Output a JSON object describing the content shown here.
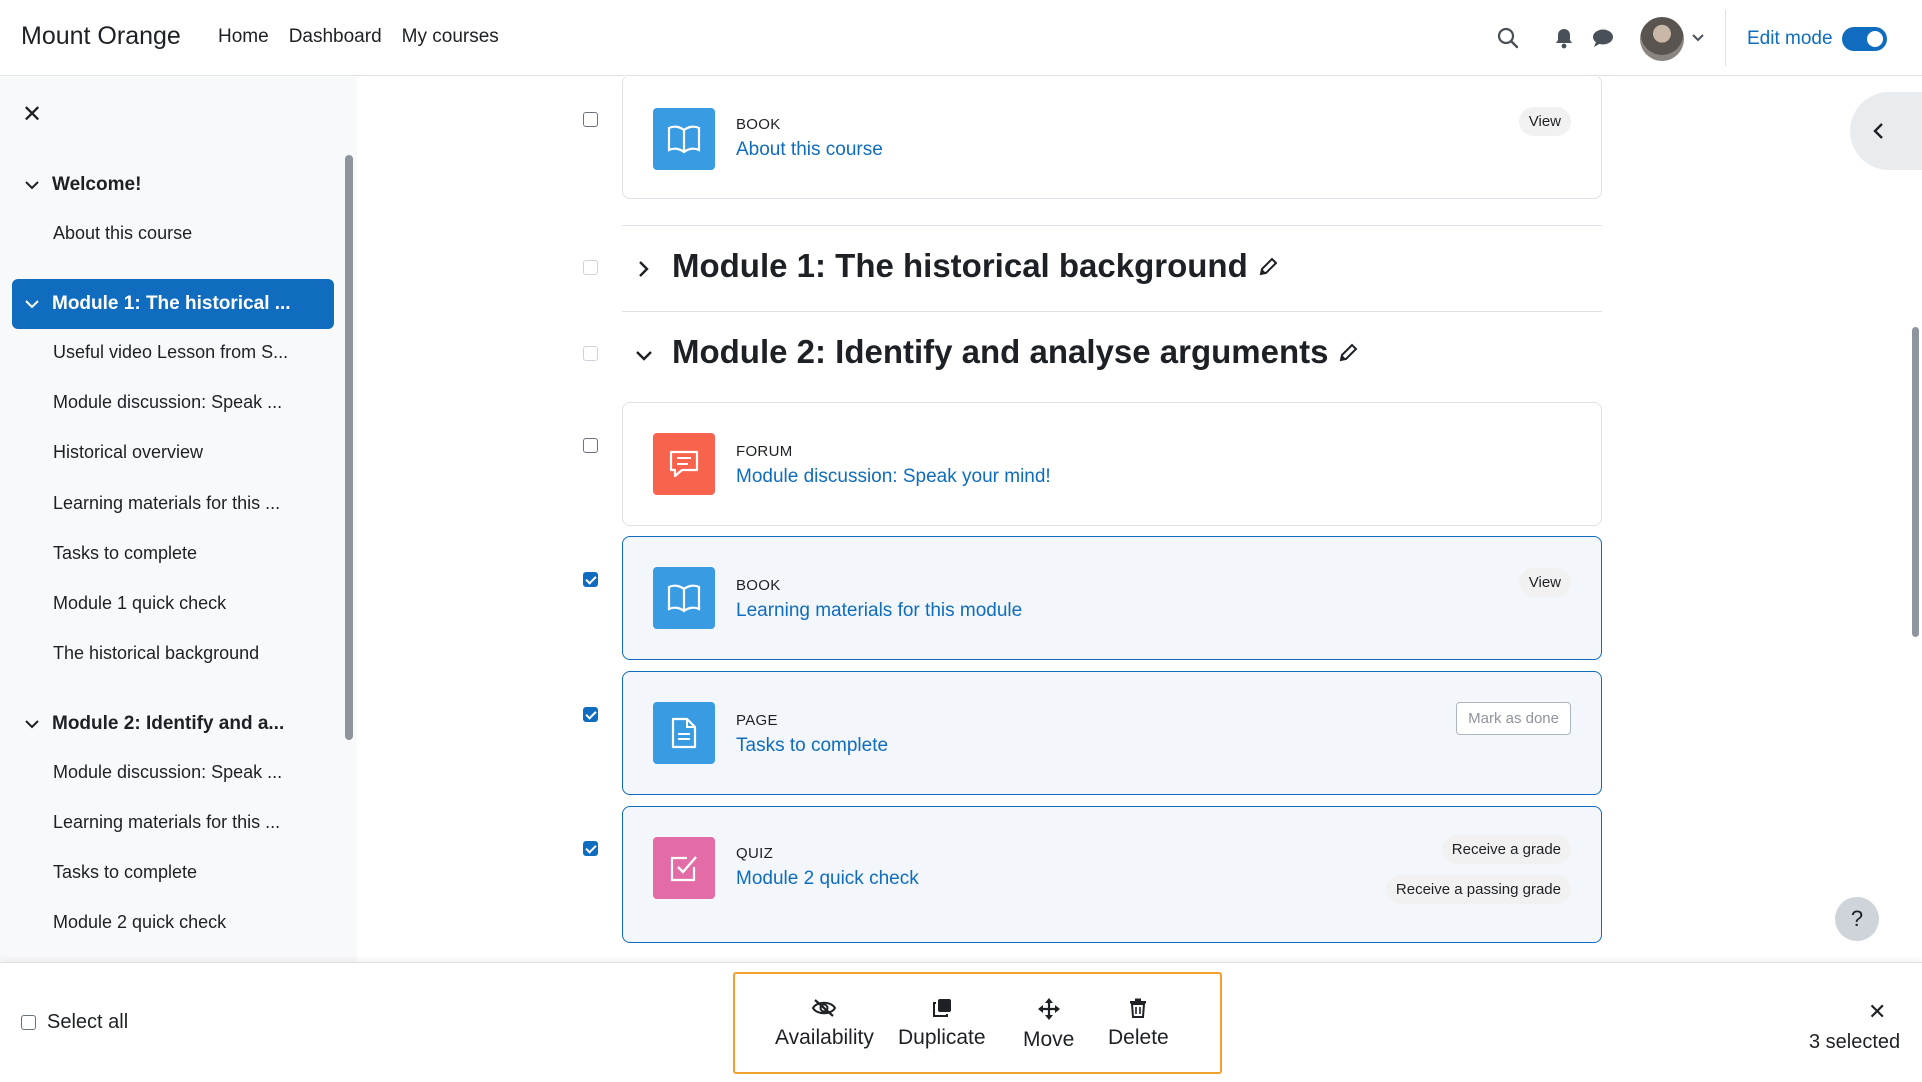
{
  "navbar": {
    "brand": "Mount Orange",
    "links": [
      "Home",
      "Dashboard",
      "My courses"
    ],
    "edit_mode_label": "Edit mode",
    "edit_mode_on": true
  },
  "drawer": {
    "sections": [
      {
        "label": "Welcome!",
        "active": false,
        "items": [
          "About this course"
        ]
      },
      {
        "label": "Module 1: The historical ...",
        "active": true,
        "items": [
          "Useful video Lesson from S...",
          "Module discussion: Speak ...",
          "Historical overview",
          "Learning materials for this ...",
          "Tasks to complete",
          "Module 1 quick check",
          "The historical background"
        ]
      },
      {
        "label": "Module 2: Identify and a...",
        "active": false,
        "items": [
          "Module discussion: Speak ...",
          "Learning materials for this ...",
          "Tasks to complete",
          "Module 2 quick check"
        ]
      }
    ]
  },
  "main": {
    "activity_top": {
      "type": "BOOK",
      "name": "About this course",
      "badge": "View"
    },
    "section1_title": "Module 1: The historical background",
    "section2_title": "Module 2: Identify and analyse arguments",
    "activities": [
      {
        "type": "FORUM",
        "name": "Module discussion: Speak your mind!",
        "checked": false,
        "color": "#f7634d"
      },
      {
        "type": "BOOK",
        "name": "Learning materials for this module",
        "checked": true,
        "badge": "View",
        "color": "#399be2"
      },
      {
        "type": "PAGE",
        "name": "Tasks to complete",
        "checked": true,
        "button": "Mark as done",
        "color": "#399be2"
      },
      {
        "type": "QUIZ",
        "name": "Module 2 quick check",
        "checked": true,
        "badges": [
          "Receive a grade",
          "Receive a passing grade"
        ],
        "color": "#e36ba6"
      }
    ],
    "help": "?"
  },
  "bulk": {
    "select_all": "Select all",
    "actions": [
      "Availability",
      "Duplicate",
      "Move",
      "Delete"
    ],
    "selected_count": "3 selected"
  },
  "colors": {
    "primary": "#0f6cbf",
    "highlight_box": "#f0a030"
  }
}
